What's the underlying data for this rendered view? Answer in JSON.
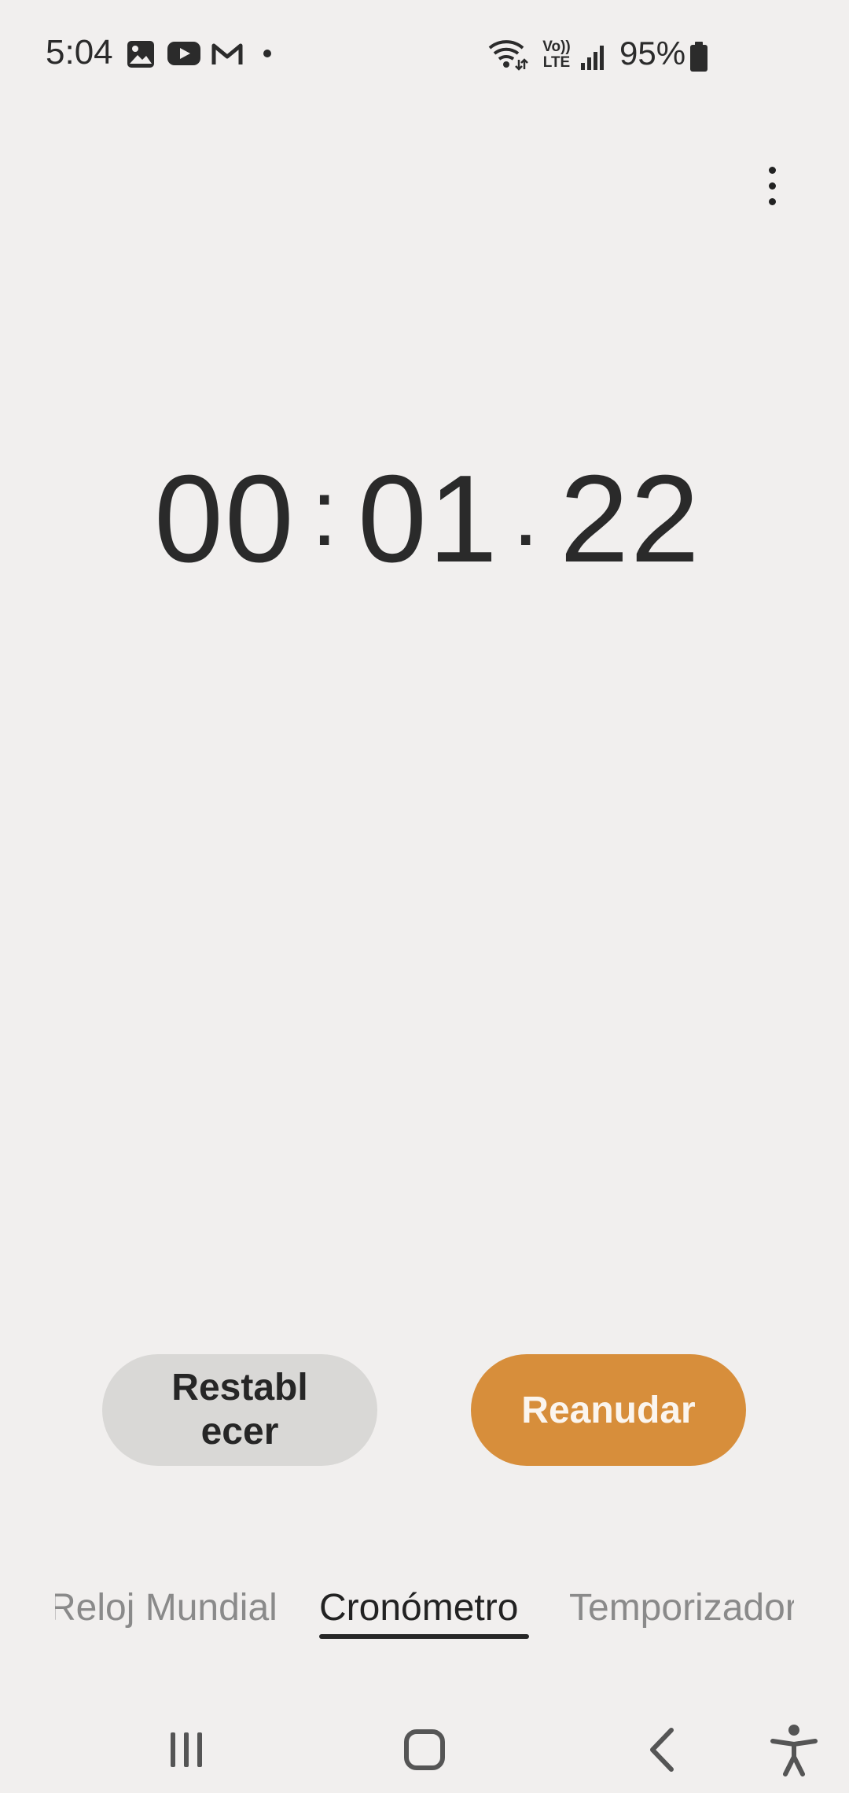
{
  "status_bar": {
    "time": "5:04",
    "battery": "95%",
    "icons": [
      "gallery-icon",
      "youtube-icon",
      "gmail-icon",
      "notification-dot-icon",
      "wifi-icon",
      "volte-icon",
      "signal-icon",
      "battery-icon"
    ],
    "volte_label_top": "Vo))",
    "volte_label_bottom": "LTE"
  },
  "stopwatch": {
    "minutes": "00",
    "seconds": "01",
    "centiseconds": "22",
    "separator_1": ":",
    "separator_2": "."
  },
  "buttons": {
    "reset_label": "Restablecer",
    "resume_label": "Reanudar"
  },
  "tabs": [
    {
      "label": "Reloj Mundial",
      "active": false
    },
    {
      "label": "Cronómetro",
      "active": true
    },
    {
      "label": "Temporizador",
      "active": false
    }
  ],
  "colors": {
    "background": "#f1efee",
    "accent": "#d78e3b",
    "reset_button": "#d9d8d6"
  }
}
